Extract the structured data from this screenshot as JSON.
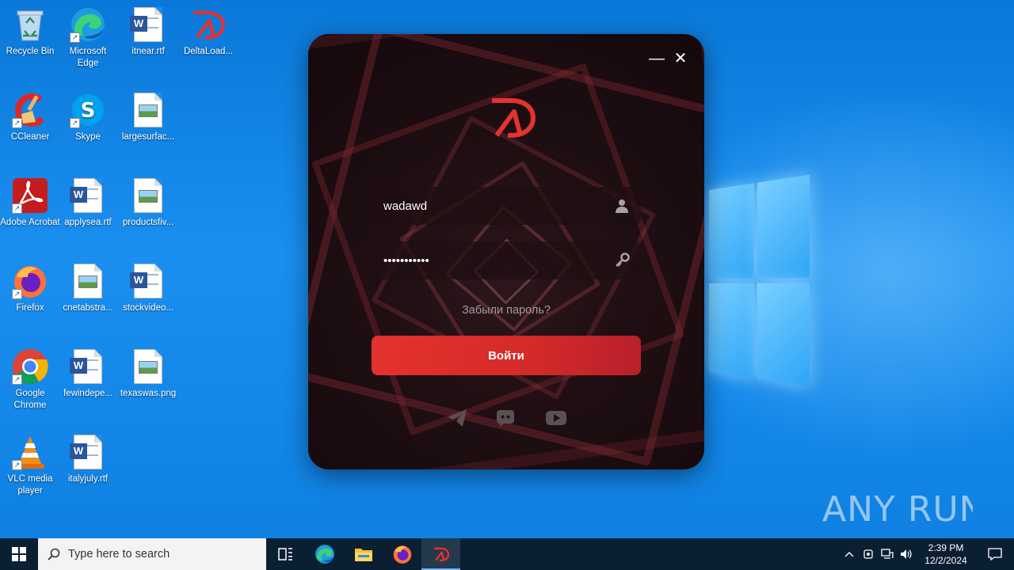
{
  "desktop": {
    "icons": [
      {
        "label": "Recycle Bin",
        "icon": "recycle-bin-icon"
      },
      {
        "label": "Microsoft Edge",
        "icon": "edge-icon"
      },
      {
        "label": "itnear.rtf",
        "icon": "word-doc-icon"
      },
      {
        "label": "DeltaLoad...",
        "icon": "deltaload-icon"
      },
      {
        "label": "CCleaner",
        "icon": "ccleaner-icon"
      },
      {
        "label": "Skype",
        "icon": "skype-icon"
      },
      {
        "label": "largesurfac...",
        "icon": "image-file-icon"
      },
      {
        "label": "Adobe Acrobat",
        "icon": "acrobat-icon"
      },
      {
        "label": "applysea.rtf",
        "icon": "word-doc-icon"
      },
      {
        "label": "productsfiv...",
        "icon": "image-file-icon"
      },
      {
        "label": "Firefox",
        "icon": "firefox-icon"
      },
      {
        "label": "cnetabstra...",
        "icon": "image-file-icon"
      },
      {
        "label": "stockvideo...",
        "icon": "word-doc-icon"
      },
      {
        "label": "Google Chrome",
        "icon": "chrome-icon"
      },
      {
        "label": "fewindepe...",
        "icon": "word-doc-icon"
      },
      {
        "label": "texaswas.png",
        "icon": "image-file-icon"
      },
      {
        "label": "VLC media player",
        "icon": "vlc-icon"
      },
      {
        "label": "italyjuly.rtf",
        "icon": "word-doc-icon"
      }
    ],
    "watermark": "ANY RUN"
  },
  "app": {
    "minimize_label": "—",
    "close_label": "✕",
    "username": {
      "value": "wadawd",
      "icon": "user-icon"
    },
    "password": {
      "value": "wadawdwadaw",
      "icon": "key-icon"
    },
    "forgot_label": "Забыли пароль?",
    "login_label": "Войти",
    "social": [
      "telegram-icon",
      "discord-icon",
      "youtube-icon"
    ],
    "accent": "#e4322e"
  },
  "taskbar": {
    "search_placeholder": "Type here to search",
    "apps": [
      "task-view-icon",
      "edge-icon",
      "file-explorer-icon",
      "firefox-icon",
      "deltaload-icon"
    ],
    "active_app": "deltaload-icon",
    "time": "2:39 PM",
    "date": "12/2/2024"
  }
}
